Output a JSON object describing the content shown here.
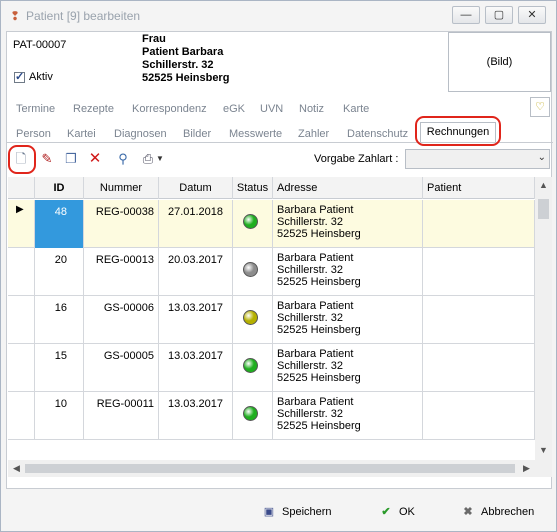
{
  "window": {
    "title": "Patient [9] bearbeiten"
  },
  "patient": {
    "id": "PAT-00007",
    "aktiv_label": "Aktiv",
    "anrede": "Frau",
    "name": "Patient Barbara",
    "strasse": "Schillerstr. 32",
    "ort": "52525 Heinsberg",
    "bild_label": "(Bild)"
  },
  "tabs_row1": [
    "Termine",
    "Rezepte",
    "Korrespondenz",
    "eGK",
    "UVN",
    "Notiz",
    "Karte"
  ],
  "tabs_row2": [
    "Person",
    "Kartei",
    "Diagnosen",
    "Bilder",
    "Messwerte",
    "Zahler",
    "Datenschutz"
  ],
  "active_tab": "Rechnungen",
  "toolbar": {
    "zahlart_label": "Vorgabe Zahlart :",
    "zahlart_value": ""
  },
  "grid": {
    "columns": [
      "ID",
      "Nummer",
      "Datum",
      "Status",
      "Adresse",
      "Patient"
    ],
    "rows": [
      {
        "id": "48",
        "nummer": "REG-00038",
        "datum": "27.01.2018",
        "status": "green",
        "adresse": [
          "Barbara Patient",
          "Schillerstr. 32",
          "52525 Heinsberg"
        ]
      },
      {
        "id": "20",
        "nummer": "REG-00013",
        "datum": "20.03.2017",
        "status": "gray",
        "adresse": [
          "Barbara Patient",
          "Schillerstr. 32",
          "52525 Heinsberg"
        ]
      },
      {
        "id": "16",
        "nummer": "GS-00006",
        "datum": "13.03.2017",
        "status": "olive",
        "adresse": [
          "Barbara Patient",
          "Schillerstr. 32",
          "52525 Heinsberg"
        ]
      },
      {
        "id": "15",
        "nummer": "GS-00005",
        "datum": "13.03.2017",
        "status": "green",
        "adresse": [
          "Barbara Patient",
          "Schillerstr. 32",
          "52525 Heinsberg"
        ]
      },
      {
        "id": "10",
        "nummer": "REG-00011",
        "datum": "13.03.2017",
        "status": "green",
        "adresse": [
          "Barbara Patient",
          "Schillerstr. 32",
          "52525 Heinsberg"
        ]
      }
    ]
  },
  "status_colors": {
    "green": "#1fae1f",
    "gray": "#8c8c8c",
    "olive": "#b5b000"
  },
  "footer": {
    "save": "Speichern",
    "ok": "OK",
    "cancel": "Abbrechen"
  }
}
